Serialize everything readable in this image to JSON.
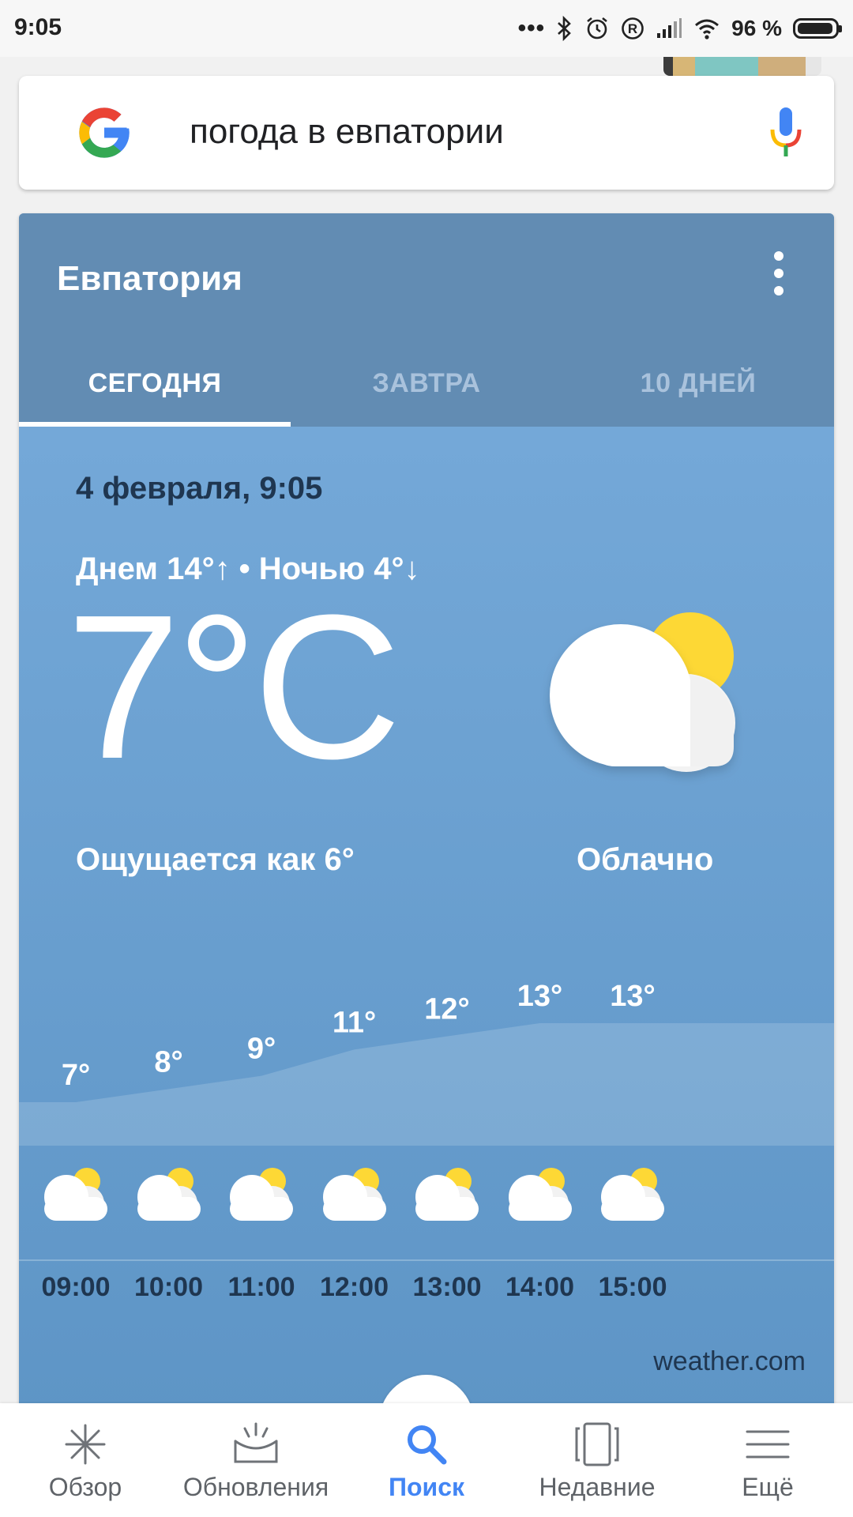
{
  "status_bar": {
    "time": "9:05",
    "battery_percent": "96 %",
    "icons": [
      "more-dots-icon",
      "bluetooth-icon",
      "alarm-icon",
      "registered-icon",
      "signal-icon",
      "wifi-icon",
      "battery-icon"
    ]
  },
  "search": {
    "query": "погода в евпатории"
  },
  "weather": {
    "city": "Евпатория",
    "tabs": [
      "СЕГОДНЯ",
      "ЗАВТРА",
      "10 ДНЕЙ"
    ],
    "active_tab": 0,
    "date": "4 февраля, 9:05",
    "day_night": "Днем 14°↑ • Ночью 4°↓",
    "temperature": "7°C",
    "feels_like": "Ощущается как 6°",
    "condition": "Облачно",
    "source": "weather.com"
  },
  "chart_data": {
    "type": "area",
    "x": [
      "09:00",
      "10:00",
      "11:00",
      "12:00",
      "13:00",
      "14:00",
      "15:00"
    ],
    "values": [
      7,
      8,
      9,
      11,
      12,
      13,
      13
    ],
    "labels": [
      "7°",
      "8°",
      "9°",
      "11°",
      "12°",
      "13°",
      "13°"
    ]
  },
  "bottom_nav": [
    {
      "label": "Обзор",
      "icon": "overview-icon"
    },
    {
      "label": "Обновления",
      "icon": "updates-icon"
    },
    {
      "label": "Поиск",
      "icon": "search-icon"
    },
    {
      "label": "Недавние",
      "icon": "recent-icon"
    },
    {
      "label": "Ещё",
      "icon": "menu-icon"
    }
  ],
  "colors": {
    "accent": "#4285f4",
    "card_header": "#628cb3",
    "card_body": "#6ea3d3",
    "sun": "#fdd835"
  }
}
